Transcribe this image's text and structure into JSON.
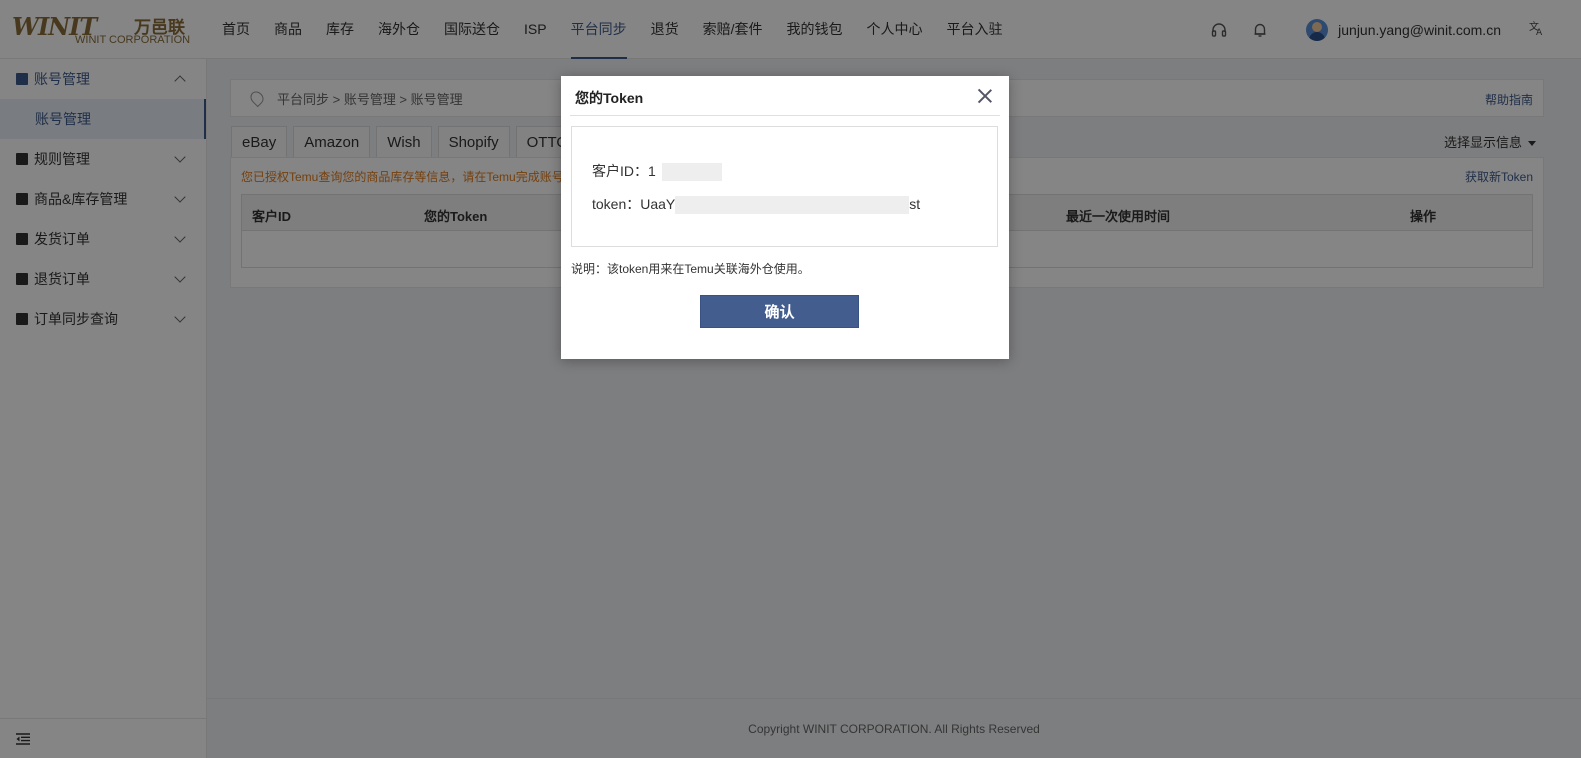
{
  "logo": {
    "mark": "WINIT",
    "cn": "万邑联",
    "en": "WINIT CORPORATION"
  },
  "nav": [
    {
      "label": "首页"
    },
    {
      "label": "商品"
    },
    {
      "label": "库存"
    },
    {
      "label": "海外仓"
    },
    {
      "label": "国际送仓"
    },
    {
      "label": "ISP"
    },
    {
      "label": "平台同步",
      "active": true
    },
    {
      "label": "退货"
    },
    {
      "label": "索赔/套件"
    },
    {
      "label": "我的钱包"
    },
    {
      "label": "个人中心"
    },
    {
      "label": "平台入驻"
    }
  ],
  "header": {
    "user_email": "junjun.yang@winit.com.cn",
    "lang_icon": "translate-icon"
  },
  "sidebar": {
    "groups": [
      {
        "label": "账号管理",
        "open": true,
        "sub": "账号管理"
      },
      {
        "label": "规则管理"
      },
      {
        "label": "商品&库存管理"
      },
      {
        "label": "发货订单"
      },
      {
        "label": "退货订单"
      },
      {
        "label": "订单同步查询"
      }
    ]
  },
  "main": {
    "breadcrumb": "平台同步 > 账号管理 > 账号管理",
    "help": "帮助指南",
    "tabs": [
      "eBay",
      "Amazon",
      "Wish",
      "Shopify",
      "OTTO"
    ],
    "display_info": "选择显示信息",
    "notice": "您已授权Temu查询您的商品库存等信息，请在Temu完成账号",
    "new_token": "获取新Token",
    "columns": [
      "客户ID",
      "您的Token",
      "最近一次使用时间",
      "操作"
    ],
    "copyright": "Copyright WINIT CORPORATION. All Rights Reserved"
  },
  "modal": {
    "title": "您的Token",
    "customer_id_label": "客户ID：",
    "customer_id_prefix": "1",
    "token_label": "token：",
    "token_prefix": "UaaY",
    "token_suffix": "st",
    "note": "说明：该token用来在Temu关联海外仓使用。",
    "confirm": "确认"
  }
}
